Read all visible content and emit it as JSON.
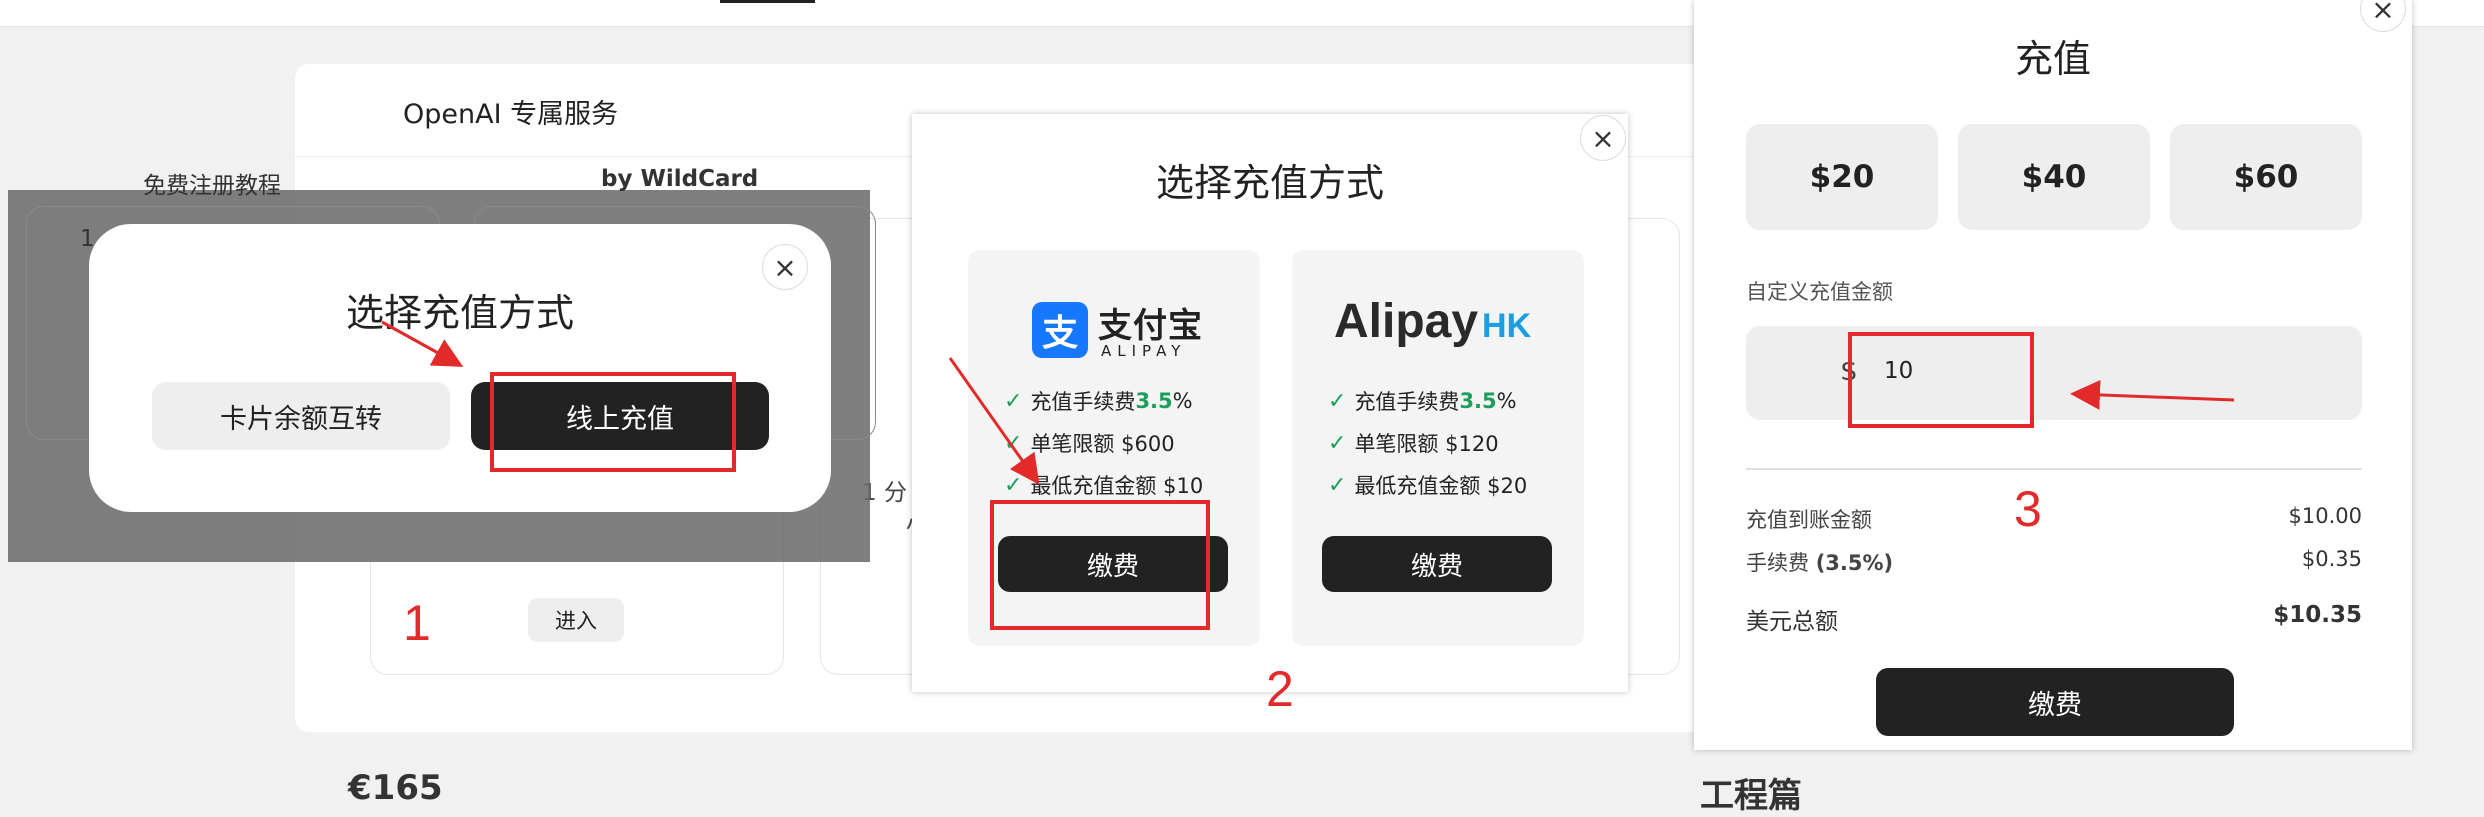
{
  "background": {
    "card_title": "OpenAI 专属服务",
    "partial_left": "免费注册教程",
    "partial_by": "by WildCard",
    "partial_num": "1",
    "partial_mid": "1 分",
    "partial_mid2": "小",
    "enter_label": "进入",
    "bottom_left": "€165",
    "bottom_right": "工程篇"
  },
  "panel1": {
    "title": "选择充值方式",
    "card_transfer_label": "卡片余额互转",
    "online_recharge_label": "线上充值",
    "close": "×"
  },
  "panel2": {
    "title": "选择充值方式",
    "close": "×",
    "alipay": {
      "logo_cn": "支付宝",
      "logo_en": "ALIPAY",
      "features": [
        {
          "prefix": "充值手续费 ",
          "highlight": "3.5",
          "suffix": "%"
        },
        {
          "prefix": "单笔限额 $600",
          "highlight": "",
          "suffix": ""
        },
        {
          "prefix": "最低充值金额 $10",
          "highlight": "",
          "suffix": ""
        }
      ],
      "pay_label": "缴费"
    },
    "alipayhk": {
      "logo_main": "Alipay",
      "logo_hk": "HK",
      "features": [
        {
          "prefix": "充值手续费 ",
          "highlight": "3.5",
          "suffix": "%"
        },
        {
          "prefix": "单笔限额 $120",
          "highlight": "",
          "suffix": ""
        },
        {
          "prefix": "最低充值金额 $20",
          "highlight": "",
          "suffix": ""
        }
      ],
      "pay_label": "缴费"
    }
  },
  "panel3": {
    "title": "充值",
    "close": "×",
    "amounts": [
      "$20",
      "$40",
      "$60"
    ],
    "custom_label": "自定义充值金额",
    "currency_symbol": "$",
    "custom_value": "10",
    "rows": [
      {
        "label": "充值到账金额",
        "value": "$10.00"
      },
      {
        "label_prefix": "手续费 ",
        "label_bold": "(3.5%)",
        "value": "$0.35"
      },
      {
        "label": "美元总额",
        "value": "$10.35"
      }
    ],
    "pay_label": "缴费"
  },
  "annotations": {
    "step1": "1",
    "step2": "2",
    "step3": "3",
    "color": "#e32a2a"
  },
  "colors": {
    "dark_button": "#222222",
    "fee_green": "#1d9e5a",
    "alipay_blue": "#1677ff",
    "alipayhk_blue": "#1a9ee0"
  }
}
